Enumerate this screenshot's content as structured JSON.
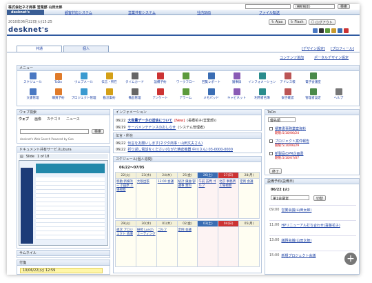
{
  "header": {
    "company": "株式会社ネオ商事 営業部 山田太郎",
    "search_placeholder": "",
    "search_scope": "(横断検索)",
    "search_button": "検索"
  },
  "topnav": [
    "desknet's",
    "顧客対応システム",
    "営業共有システム",
    "社内SNS",
    "ファイル転送"
  ],
  "datetime": "2010年06月22日(火)15:25",
  "toolbar": {
    "ajax": "Ajax",
    "flash": "Flash",
    "logout": "ログアウト"
  },
  "logo": "desknet's",
  "tabs": {
    "common": "共通",
    "personal": "個人"
  },
  "design_links": {
    "design": "[デザイン設定]",
    "profile": "[プロフィール]",
    "content_add": "コンテンツ追加",
    "portal_design": "ポータルデザイン設定"
  },
  "menu": {
    "title": "メニュー",
    "row1": [
      "スケジュール",
      "ToDo",
      "ウェブメール",
      "伝言・所在",
      "タイムカード",
      "設備予約",
      "ワークフロー",
      "回覧レポート",
      "議事録",
      "インフォメーション",
      "アドレス帳",
      "電子会議室"
    ],
    "row2": [
      "文書管理",
      "購買予約",
      "プロジェクト管理",
      "勤怠集約",
      "備品管理",
      "アンケート",
      "アラーム",
      "メモパッド",
      "キャビネット",
      "利用者名簿",
      "安否確認",
      "管理者設定",
      "ヘルプ"
    ]
  },
  "web_search": {
    "title": "ウェブ検索",
    "tabs": [
      "ウェブ",
      "画像",
      "カテゴリ",
      "ニュース"
    ],
    "button": "検索",
    "note": "desknet's Web Search Powered by Goo"
  },
  "doc_share": {
    "title": "ドキュメント共有サービスLibura",
    "slide": "Slide",
    "page": "1 of 18"
  },
  "thumbnail": {
    "title": "サムネイル"
  },
  "sticky": {
    "title": "付箋",
    "item": "10/06/22(火) 12:59"
  },
  "information": {
    "title": "インフォメーション",
    "rows": [
      {
        "date": "06/22",
        "text": "大容量データの送信について",
        "badge": "[New]",
        "who": "(長橋花子(営業部))"
      },
      {
        "date": "06/19",
        "text": "サーバメンテナンスのおしらせ",
        "who": "(システム管理者)"
      }
    ]
  },
  "messages": {
    "title": "伝言・所在",
    "rows": [
      {
        "date": "06/22",
        "text": "伝言をお願いします(ネクタ商事・山田文夫さん)"
      },
      {
        "date": "06/22",
        "text": "折り返し電話をください(ながた精密機器 中川さん) 03-0000-0000"
      }
    ]
  },
  "schedule": {
    "title": "スケジュール(個人週間)",
    "range": "06/22～07/05",
    "days": [
      "22(火)",
      "23(水)",
      "24(木)",
      "25(金)",
      "26(土)",
      "27(日)",
      "28(月)"
    ],
    "week2": [
      "29(火)",
      "30(水)",
      "01(木)",
      "02(金)",
      "03(土)",
      "04(日)",
      "05(月)"
    ],
    "events": [
      "移動:新横浜~ 小田原 工場視察",
      "大阪出張",
      "13:00 会議",
      "統計 鎌倉/部 議事 資料",
      "午前 訪問 ゴルフ",
      "北京 事務所 工場視察",
      "定例 会議",
      "週次 プロジェクト 会議",
      "研修 Lunch ミーティング",
      "ゴルフ",
      "定例 会議"
    ]
  },
  "todo": {
    "title": "ToDo",
    "filter": "優先順",
    "items": [
      {
        "text": "積算書事務業案資料",
        "due": "期限:5/10/06/24"
      },
      {
        "text": "プロジェクト案件報告",
        "due": "期限:5/10/06/29"
      },
      {
        "text": "新製品のPR企画書",
        "due": "期限:5/10/07/07"
      }
    ],
    "done": "終了"
  },
  "equip": {
    "title": "設備予約(設備日)",
    "date": "06/22 (火)",
    "room": "第1会議室",
    "switch": "切替",
    "rows": [
      {
        "t": "09:00",
        "text": "営業会議(山田太郎)"
      },
      {
        "t": "11:00",
        "text": "HPリニューアル打ち合わせ(喜藤花子)"
      },
      {
        "t": "13:00",
        "text": "議題会議(山田太郎)"
      },
      {
        "t": "15:00",
        "text": "新規プロジェクト会議"
      }
    ]
  }
}
